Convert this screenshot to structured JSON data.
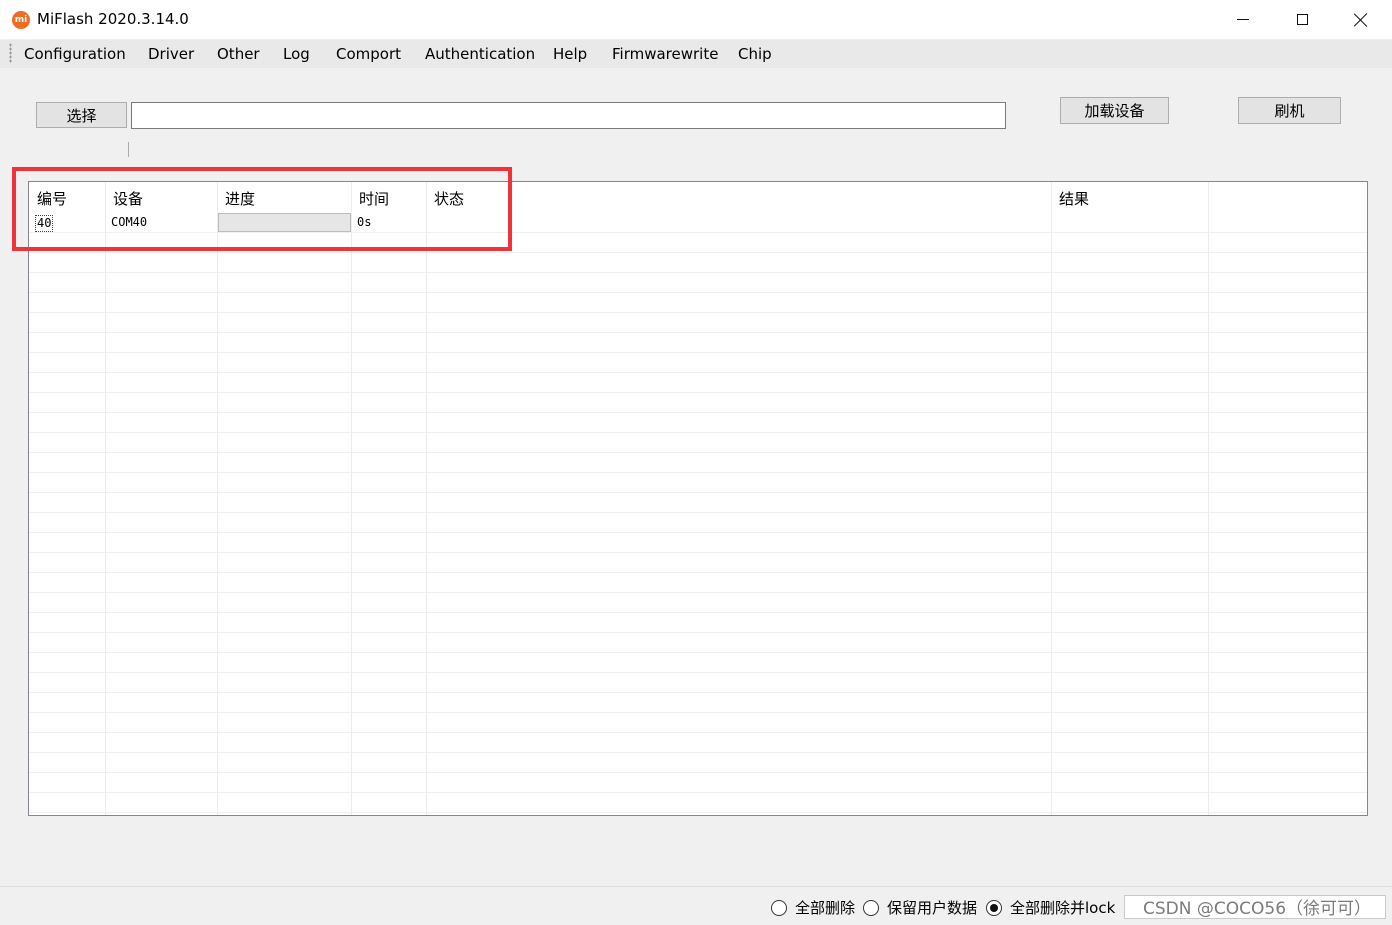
{
  "window": {
    "title": "MiFlash 2020.3.14.0",
    "app_icon_text": "mi",
    "accent_color": "#f06a24"
  },
  "menu": [
    "Configuration",
    "Driver",
    "Other",
    "Log",
    "Comport",
    "Authentication",
    "Help",
    "Firmwarewrite",
    "Chip"
  ],
  "toolbar": {
    "select_label": "选择",
    "path_value": "",
    "load_devices_label": "加载设备",
    "flash_label": "刷机"
  },
  "table": {
    "columns": [
      "编号",
      "设备",
      "进度",
      "时间",
      "状态",
      "结果"
    ],
    "rows": [
      {
        "id": "40",
        "device": "COM40",
        "progress": 0,
        "time": "0s",
        "status": "",
        "result": ""
      }
    ]
  },
  "highlight_color": "#f0333a",
  "options": {
    "items": [
      "全部删除",
      "保留用户数据",
      "全部删除并lock"
    ],
    "selected": "全部删除并lock"
  },
  "watermark": "CSDN @COCO56（徐可可）"
}
